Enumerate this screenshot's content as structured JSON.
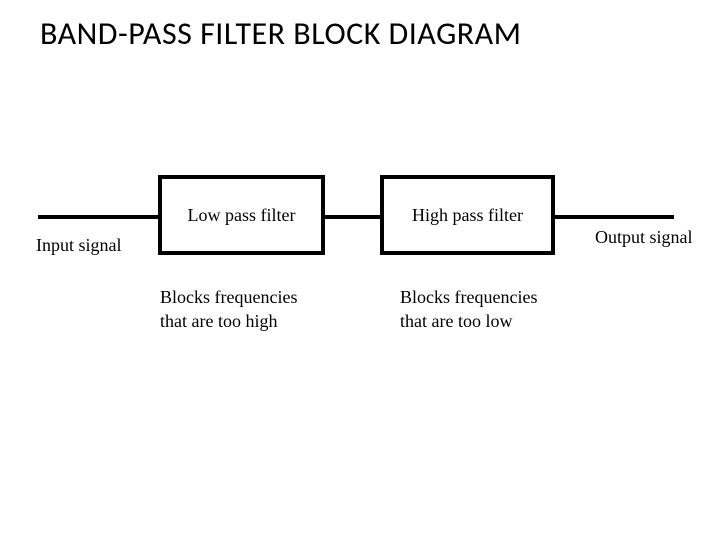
{
  "title": "BAND-PASS FILTER BLOCK DIAGRAM",
  "diagram": {
    "input_label": "Input signal",
    "output_label": "Output signal",
    "lpf": {
      "box_label": "Low pass filter",
      "description_line1": "Blocks frequencies",
      "description_line2": "that are too high"
    },
    "hpf": {
      "box_label": "High pass filter",
      "description_line1": "Blocks frequencies",
      "description_line2": "that are too low"
    }
  }
}
